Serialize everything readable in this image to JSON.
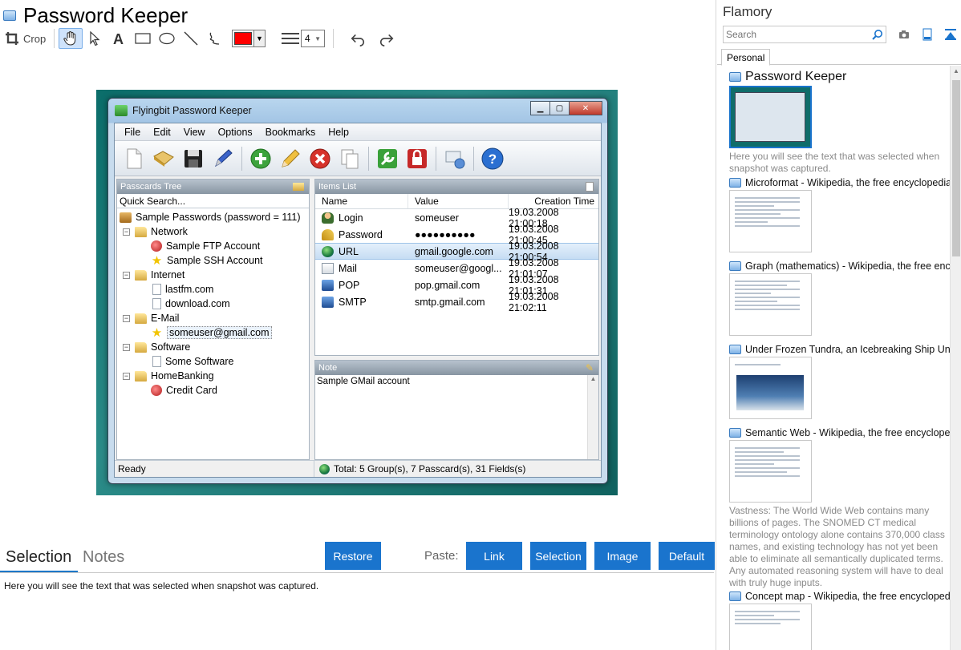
{
  "header": {
    "title": "Password Keeper",
    "crop_label": "Crop",
    "line_width": "4",
    "stroke_color": "#ff0000"
  },
  "app": {
    "title": "Flyingbit Password Keeper",
    "menu": [
      "File",
      "Edit",
      "View",
      "Options",
      "Bookmarks",
      "Help"
    ],
    "tree_header": "Passcards Tree",
    "quick_search": "Quick Search...",
    "tree_root": "Sample Passwords (password = 111)",
    "tree": [
      {
        "label": "Network",
        "children": [
          {
            "label": "Sample FTP Account",
            "icon": "red-circle-icon"
          },
          {
            "label": "Sample SSH Account",
            "icon": "star-icon"
          }
        ]
      },
      {
        "label": "Internet",
        "children": [
          {
            "label": "lastfm.com",
            "icon": "document-icon"
          },
          {
            "label": "download.com",
            "icon": "document-icon"
          }
        ]
      },
      {
        "label": "E-Mail",
        "children": [
          {
            "label": "someuser@gmail.com",
            "icon": "star-icon"
          }
        ]
      },
      {
        "label": "Software",
        "children": [
          {
            "label": "Some Software",
            "icon": "document-icon"
          }
        ]
      },
      {
        "label": "HomeBanking",
        "children": [
          {
            "label": "Credit Card",
            "icon": "red-circle-icon"
          }
        ]
      }
    ],
    "items_header": "Items List",
    "columns": {
      "name": "Name",
      "value": "Value",
      "time": "Creation Time"
    },
    "items": [
      {
        "name": "Login",
        "value": "someuser",
        "time": "19.03.2008 21:00:18",
        "icon": "user-icon"
      },
      {
        "name": "Password",
        "value": "●●●●●●●●●●",
        "time": "19.03.2008 21:00:45",
        "icon": "key-icon"
      },
      {
        "name": "URL",
        "value": "gmail.google.com",
        "time": "19.03.2008 21:00:54",
        "icon": "globe-icon"
      },
      {
        "name": "Mail",
        "value": "someuser@googl...",
        "time": "19.03.2008 21:01:07",
        "icon": "mail-icon"
      },
      {
        "name": "POP",
        "value": "pop.gmail.com",
        "time": "19.03.2008 21:01:31",
        "icon": "computer-icon"
      },
      {
        "name": "SMTP",
        "value": "smtp.gmail.com",
        "time": "19.03.2008 21:02:11",
        "icon": "computer-icon"
      }
    ],
    "note_header": "Note",
    "note_text": "Sample GMail account",
    "status_left": "Ready",
    "status_right": "Total: 5 Group(s), 7 Passcard(s), 31 Fields(s)"
  },
  "bottom": {
    "tab_selection": "Selection",
    "tab_notes": "Notes",
    "restore": "Restore",
    "paste_label": "Paste:",
    "link": "Link",
    "selection": "Selection",
    "image": "Image",
    "default": "Default",
    "selection_text": "Here you will see the text that was selected when snapshot was captured."
  },
  "sidebar": {
    "title": "Flamory",
    "search_placeholder": "Search",
    "tab": "Personal",
    "snapshots": [
      {
        "title": "Password Keeper",
        "desc": "Here you will see the text that was selected when snapshot was captured."
      },
      {
        "title": "Microformat - Wikipedia, the free encyclopedia",
        "desc": ""
      },
      {
        "title": "Graph (mathematics) - Wikipedia, the free ency",
        "desc": ""
      },
      {
        "title": "Under Frozen Tundra, an Icebreaking Ship Unco",
        "desc": ""
      },
      {
        "title": "Semantic Web - Wikipedia, the free encycloped",
        "desc": "Vastness: The World Wide Web contains many billions of pages. The SNOMED CT medical terminology ontology alone contains 370,000 class names, and existing technology has not yet been able to eliminate all semantically duplicated terms. Any automated reasoning system will have to deal with truly huge inputs."
      },
      {
        "title": "Concept map - Wikipedia, the free encyclopedi",
        "desc": ""
      }
    ]
  }
}
